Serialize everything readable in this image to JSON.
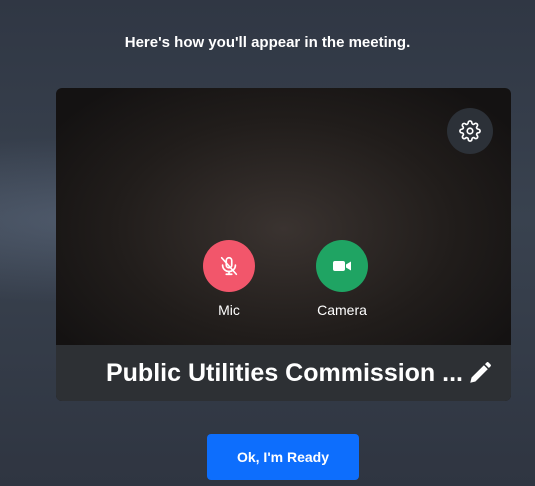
{
  "header": {
    "title": "Here's how you'll appear in the meeting."
  },
  "preview": {
    "settings_icon": "gear-icon",
    "controls": {
      "mic": {
        "label": "Mic",
        "icon": "mic-off-icon",
        "color": "#f2566b"
      },
      "camera": {
        "label": "Camera",
        "icon": "video-camera-icon",
        "color": "#1fa463"
      }
    },
    "display_name": "Public Utilities Commission ...",
    "edit_icon": "pencil-icon"
  },
  "actions": {
    "ready_label": "Ok, I'm Ready",
    "ready_color": "#0d6efd"
  }
}
